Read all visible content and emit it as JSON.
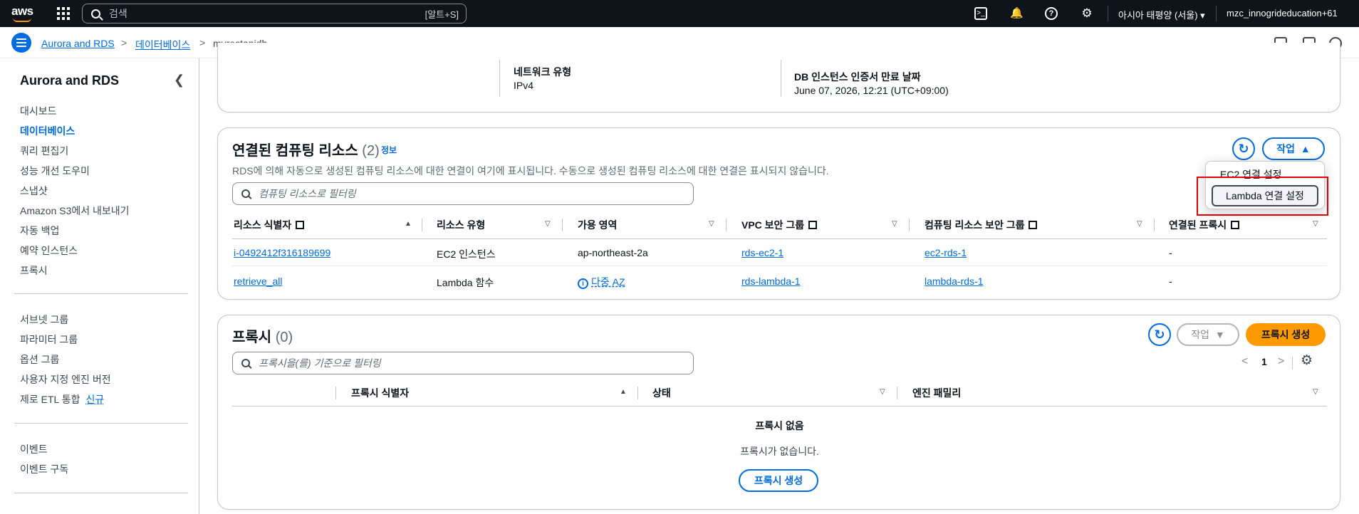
{
  "topnav": {
    "logo": "aws",
    "search_placeholder": "검색",
    "search_shortcut": "[알트+S]",
    "region": "아시아 태평양 (서울)",
    "account": "mzc_innogrideducation+61"
  },
  "breadcrumb": {
    "items": [
      "Aurora and RDS",
      "데이터베이스",
      "myrestapidb"
    ]
  },
  "sidebar": {
    "title": "Aurora and RDS",
    "group1": [
      "대시보드",
      "데이터베이스",
      "쿼리 편집기",
      "성능 개선 도우미",
      "스냅샷",
      "Amazon S3에서 내보내기",
      "자동 백업",
      "예약 인스턴스",
      "프록시"
    ],
    "group2": [
      "서브넷 그룹",
      "파라미터 그룹",
      "옵션 그룹",
      "사용자 지정 엔진 버전",
      "제로 ETL 통합"
    ],
    "new_badge": "신규",
    "group3": [
      "이벤트",
      "이벤트 구독"
    ]
  },
  "top_card": {
    "network_type_label": "네트워크 유형",
    "network_type_value": "IPv4",
    "cert_label": "DB 인스턴스 인증서 만료 날짜",
    "cert_value": "June 07, 2026, 12:21 (UTC+09:00)"
  },
  "compute_card": {
    "title": "연결된 컴퓨팅 리소스",
    "count": "(2)",
    "info": "정보",
    "description": "RDS에 의해 자동으로 생성된 컴퓨팅 리소스에 대한 연결이 여기에 표시됩니다. 수동으로 생성된 컴퓨팅 리소스에 대한 연결은 표시되지 않습니다.",
    "filter_placeholder": "컴퓨팅 리소스로 필터링",
    "actions_label": "작업",
    "dropdown": [
      "EC2 연결 설정",
      "Lambda 연결 설정"
    ],
    "columns": [
      "리소스 식별자",
      "리소스 유형",
      "가용 영역",
      "VPC 보안 그룹",
      "컴퓨팅 리소스 보안 그룹",
      "연결된 프록시"
    ],
    "rows": [
      {
        "id": "i-0492412f316189699",
        "type": "EC2 인스턴스",
        "az": "ap-northeast-2a",
        "vpc_sg": "rds-ec2-1",
        "compute_sg": "ec2-rds-1",
        "proxy": "-"
      },
      {
        "id": "retrieve_all",
        "type": "Lambda 함수",
        "az": "다중 AZ",
        "vpc_sg": "rds-lambda-1",
        "compute_sg": "lambda-rds-1",
        "proxy": "-"
      }
    ]
  },
  "proxy_card": {
    "title": "프록시",
    "count": "(0)",
    "actions_label": "작업",
    "create_label": "프록시 생성",
    "filter_placeholder": "프록시을(를) 기준으로 필터링",
    "page": "1",
    "columns": [
      "프록시 식별자",
      "상태",
      "엔진 패밀리"
    ],
    "empty_title": "프록시 없음",
    "empty_desc": "프록시가 없습니다.",
    "empty_button": "프록시 생성"
  }
}
